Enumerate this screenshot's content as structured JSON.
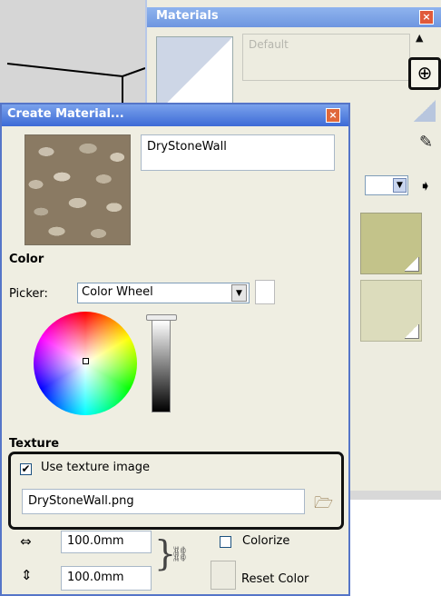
{
  "materials_window": {
    "title": "Materials",
    "close_glyph": "×",
    "material_name": "Default",
    "add_icon": "create-material-icon"
  },
  "dialog": {
    "title": "Create Material...",
    "close_glyph": "×",
    "material_name": "DryStoneWall",
    "color": {
      "heading": "Color",
      "picker_label": "Picker:",
      "picker_value": "Color Wheel"
    },
    "texture": {
      "heading": "Texture",
      "use_texture_label": "Use texture image",
      "use_texture_checked": true,
      "file_name": "DryStoneWall.png"
    },
    "size": {
      "width": "100.0mm",
      "height": "100.0mm"
    },
    "colorize_label": "Colorize",
    "colorize_checked": false,
    "reset_color_label": "Reset Color"
  }
}
